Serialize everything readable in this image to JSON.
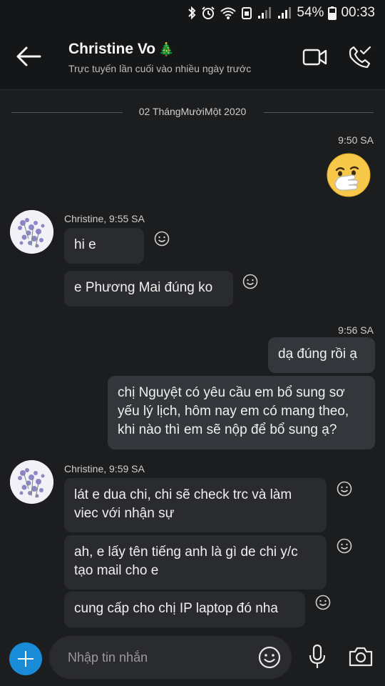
{
  "status_bar": {
    "battery": "54%",
    "time": "00:33"
  },
  "header": {
    "contact_name": "Christine Vo",
    "name_emoji": "🎄",
    "contact_status": "Trực tuyến lần cuối vào nhiều ngày trước"
  },
  "date_separator": "02 ThángMườiMột 2020",
  "messages": {
    "m1_time": "9:50 SA",
    "g1_sender": "Christine, 9:55 SA",
    "g1_msg1": "hi e",
    "g1_msg2": "e Phương Mai đúng ko",
    "m2_time": "9:56 SA",
    "m2_msg1": "dạ đúng rồi ạ",
    "m2_msg2_line1": "chị Nguyệt có yêu cầu em bổ sung sơ",
    "m2_msg2_line2": "yếu lý lịch, hôm nay em có mang theo,",
    "m2_msg2_line3": "khi nào thì em sẽ nộp để bổ sung ạ?",
    "g2_sender": "Christine, 9:59 SA",
    "g2_msg1_line1": "lát e dua chi, chi sẽ check trc và làm",
    "g2_msg1_line2": "viec với nhận sự",
    "g2_msg2_line1": "ah, e lấy tên tiếng anh là gì de chi y/c",
    "g2_msg2_line2": "tạo mail cho e",
    "g2_msg3": "cung cấp cho chị IP laptop đó nha"
  },
  "composer": {
    "placeholder": "Nhập tin nhắn"
  }
}
